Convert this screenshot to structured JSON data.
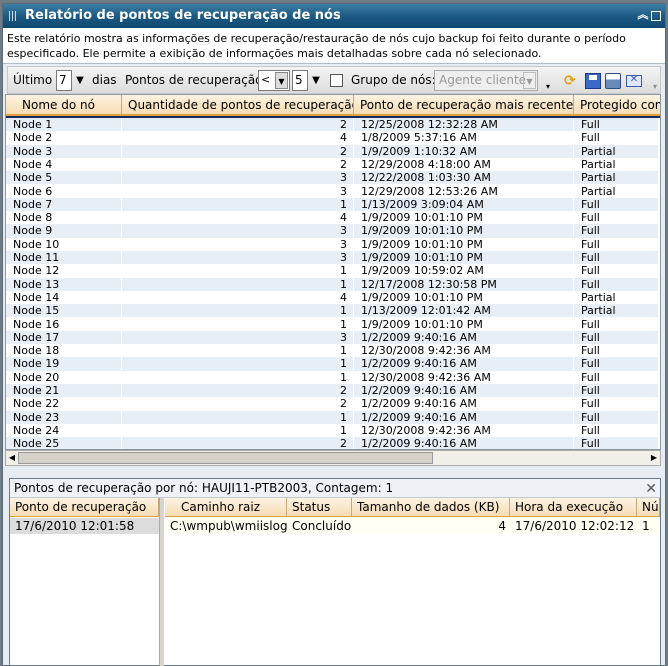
{
  "window": {
    "title": "Relatório de pontos de recuperação de nós",
    "collapse_icon": "double-chevron-up",
    "maximize_icon": "square"
  },
  "description": "Este relatório mostra as informações de recuperação/restauração de nós cujo backup foi feito durante o período especificado. Ele permite a exibição de informações mais detalhadas sobre cada nó selecionado.",
  "toolbar": {
    "last_label": "Último",
    "days_value": "7",
    "days_label": "dias",
    "points_label": "Pontos de recuperação",
    "operator_value": "<",
    "points_value": "5",
    "group_label": "Grupo de nós:",
    "group_value": "Agente cliente",
    "group_checked": false,
    "icons": [
      "refresh",
      "save",
      "print",
      "email"
    ]
  },
  "table": {
    "columns": [
      "Nome do nó",
      "Quantidade de pontos de recuperação",
      "Ponto de recuperação mais recente",
      "Protegido completamente"
    ],
    "rows": [
      [
        "Node 1",
        "2",
        "12/25/2008 12:32:28 AM",
        "Full"
      ],
      [
        "Node 2",
        "4",
        "1/8/2009 5:37:16 AM",
        "Full"
      ],
      [
        "Node 3",
        "2",
        "1/9/2009 1:10:32 AM",
        "Partial"
      ],
      [
        "Node 4",
        "2",
        "12/29/2008 4:18:00 AM",
        "Partial"
      ],
      [
        "Node 5",
        "3",
        "12/22/2008 1:03:30 AM",
        "Partial"
      ],
      [
        "Node 6",
        "3",
        "12/29/2008 12:53:26 AM",
        "Partial"
      ],
      [
        "Node 7",
        "1",
        "1/13/2009 3:09:04 AM",
        "Full"
      ],
      [
        "Node 8",
        "4",
        "1/9/2009 10:01:10 PM",
        "Full"
      ],
      [
        "Node 9",
        "3",
        "1/9/2009 10:01:10 PM",
        "Full"
      ],
      [
        "Node 10",
        "3",
        "1/9/2009 10:01:10 PM",
        "Full"
      ],
      [
        "Node 11",
        "3",
        "1/9/2009 10:01:10 PM",
        "Full"
      ],
      [
        "Node 12",
        "1",
        "1/9/2009 10:59:02 AM",
        "Full"
      ],
      [
        "Node 13",
        "1",
        "12/17/2008 12:30:58 PM",
        "Full"
      ],
      [
        "Node 14",
        "4",
        "1/9/2009 10:01:10 PM",
        "Partial"
      ],
      [
        "Node 15",
        "1",
        "1/13/2009 12:01:42 AM",
        "Partial"
      ],
      [
        "Node 16",
        "1",
        "1/9/2009 10:01:10 PM",
        "Full"
      ],
      [
        "Node 17",
        "3",
        "1/2/2009 9:40:16 AM",
        "Full"
      ],
      [
        "Node 18",
        "1",
        "12/30/2008 9:42:36 AM",
        "Full"
      ],
      [
        "Node 19",
        "1",
        "1/2/2009 9:40:16 AM",
        "Full"
      ],
      [
        "Node 20",
        "1",
        "12/30/2008 9:42:36 AM",
        "Full"
      ],
      [
        "Node 21",
        "2",
        "1/2/2009 9:40:16 AM",
        "Full"
      ],
      [
        "Node 22",
        "2",
        "1/2/2009 9:40:16 AM",
        "Full"
      ],
      [
        "Node 23",
        "1",
        "1/2/2009 9:40:16 AM",
        "Full"
      ],
      [
        "Node 24",
        "1",
        "12/30/2008 9:42:36 AM",
        "Full"
      ],
      [
        "Node 25",
        "2",
        "1/2/2009 9:40:16 AM",
        "Full"
      ]
    ]
  },
  "detail": {
    "title": "Pontos de recuperação por nó: HAUJI11-PTB2003, Contagem: 1",
    "left_column": "Ponto de recuperação",
    "left_rows": [
      "17/6/2010 12:01:58"
    ],
    "columns": [
      "Caminho raiz",
      "Status",
      "Tamanho de dados (KB)",
      "Hora da execução",
      "Número"
    ],
    "rows": [
      [
        "C:\\wmpub\\wmiislog",
        "Concluído",
        "4",
        "17/6/2010 12:02:12",
        "1"
      ]
    ]
  }
}
